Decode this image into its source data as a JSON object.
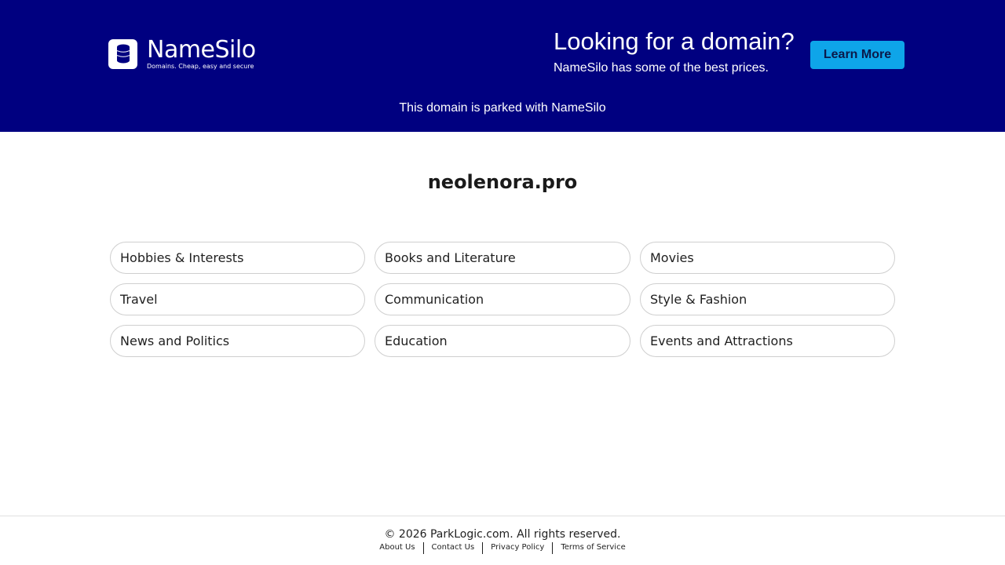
{
  "header": {
    "logo_name": "NameSilo",
    "logo_tagline": "Domains. Cheap, easy and secure",
    "promo_title": "Looking for a domain?",
    "promo_subtitle": "NameSilo has some of the best prices.",
    "cta_label": "Learn More",
    "parked_notice": "This domain is parked with NameSilo"
  },
  "main": {
    "domain": "neolenora.pro",
    "topics": [
      {
        "label": "Hobbies & Interests"
      },
      {
        "label": "Books and Literature"
      },
      {
        "label": "Movies"
      },
      {
        "label": "Travel"
      },
      {
        "label": "Communication"
      },
      {
        "label": "Style & Fashion"
      },
      {
        "label": "News and Politics"
      },
      {
        "label": "Education"
      },
      {
        "label": "Events and Attractions"
      }
    ]
  },
  "footer": {
    "copyright": "© 2026 ParkLogic.com. All rights reserved.",
    "links": [
      {
        "label": "About Us"
      },
      {
        "label": "Contact Us"
      },
      {
        "label": "Privacy Policy"
      },
      {
        "label": "Terms of Service"
      }
    ]
  },
  "colors": {
    "banner_bg": "#000080",
    "cta_bg": "#0ea5e9",
    "topic_border": "#cfcfcf"
  },
  "icons": {
    "logo": "database-icon"
  }
}
